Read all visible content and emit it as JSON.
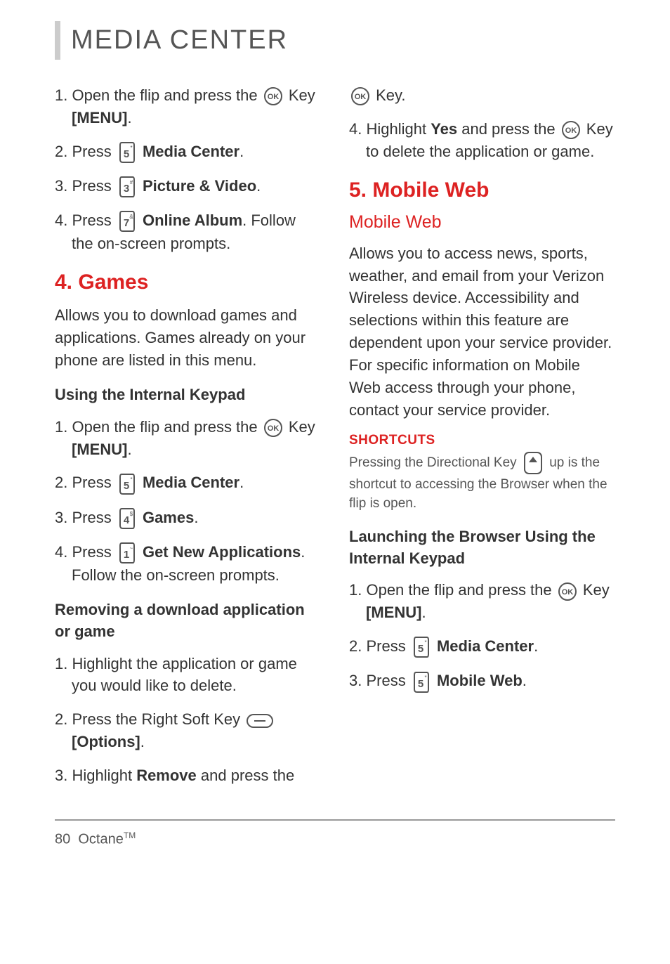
{
  "header": {
    "title": "MEDIA CENTER"
  },
  "left": {
    "steps_a": [
      {
        "num": "1.",
        "prefix": "Open the flip and press the ",
        "icon": "ok",
        "suffix1": " Key ",
        "bold": "[MENU]",
        "suffix2": "."
      },
      {
        "num": "2.",
        "prefix": "Press ",
        "icon": "key5",
        "suffix1": " ",
        "bold": "Media Center",
        "suffix2": "."
      },
      {
        "num": "3.",
        "prefix": "Press ",
        "icon": "key3",
        "suffix1": " ",
        "bold": "Picture & Video",
        "suffix2": "."
      },
      {
        "num": "4.",
        "prefix": "Press ",
        "icon": "key7",
        "suffix1": " ",
        "bold": "Online Album",
        "suffix2": ". Follow the on-screen prompts."
      }
    ],
    "games_heading": "4. Games",
    "games_intro": "Allows you to download games and applications. Games already on your phone are listed in this menu.",
    "using_keypad": "Using the Internal Keypad",
    "steps_b": [
      {
        "num": "1.",
        "prefix": "Open the flip and press the ",
        "icon": "ok",
        "suffix1": " Key ",
        "bold": "[MENU]",
        "suffix2": "."
      },
      {
        "num": "2.",
        "prefix": "Press ",
        "icon": "key5",
        "suffix1": " ",
        "bold": "Media Center",
        "suffix2": "."
      },
      {
        "num": "3.",
        "prefix": "Press ",
        "icon": "key4",
        "suffix1": " ",
        "bold": "Games",
        "suffix2": "."
      },
      {
        "num": "4.",
        "prefix": "Press ",
        "icon": "key1",
        "suffix1": " ",
        "bold": "Get New Applications",
        "suffix2": ". Follow the on-screen prompts."
      }
    ],
    "removing_heading": "Removing a download application or game",
    "steps_c": [
      {
        "num": "1.",
        "text": "Highlight the application or game you would like to delete."
      },
      {
        "num": "2.",
        "prefix": "Press the Right Soft Key ",
        "icon": "softkey",
        "suffix1": " ",
        "bold": "[Options]",
        "suffix2": "."
      },
      {
        "num": "3.",
        "prefix": "Highlight ",
        "bold": "Remove",
        "suffix2": " and press the"
      }
    ]
  },
  "right": {
    "cont_icon": "ok",
    "cont_text": " Key.",
    "step4_num": "4.",
    "step4_prefix": "Highlight ",
    "step4_bold": "Yes",
    "step4_mid": " and press the ",
    "step4_icon": "ok",
    "step4_suffix": " Key to delete the application or game.",
    "mw_heading": "5. Mobile Web",
    "mw_sub": "Mobile Web",
    "mw_para": "Allows you to access news, sports, weather, and email from your Verizon Wireless device. Accessibility and selections within this feature are dependent upon your service provider. For specific information on Mobile Web access through your phone, contact your service provider.",
    "shortcuts_label": "SHORTCUTS",
    "shortcuts_p1": "Pressing the Directional Key ",
    "shortcuts_p2": " up is the shortcut to accessing the Browser when the flip is open.",
    "launch_heading": "Launching the Browser Using the Internal Keypad",
    "steps_d": [
      {
        "num": "1.",
        "prefix": "Open the flip and press the ",
        "icon": "ok",
        "suffix1": " Key ",
        "bold": "[MENU]",
        "suffix2": "."
      },
      {
        "num": "2.",
        "prefix": "Press ",
        "icon": "key5",
        "suffix1": " ",
        "bold": "Media Center",
        "suffix2": "."
      },
      {
        "num": "3.",
        "prefix": "Press ",
        "icon": "key5",
        "suffix1": " ",
        "bold": "Mobile Web",
        "suffix2": "."
      }
    ]
  },
  "footer": {
    "page": "80",
    "product": "Octane",
    "tm": "TM"
  },
  "icons": {
    "ok": "ok-icon",
    "key5": {
      "digit": "5",
      "sup": "*"
    },
    "key3": {
      "digit": "3",
      "sup": "#"
    },
    "key7": {
      "digit": "7",
      "sup": "&"
    },
    "key4": {
      "digit": "4",
      "sup": "$"
    },
    "key1": {
      "digit": "1",
      "sup": "~"
    },
    "dir": "up"
  }
}
